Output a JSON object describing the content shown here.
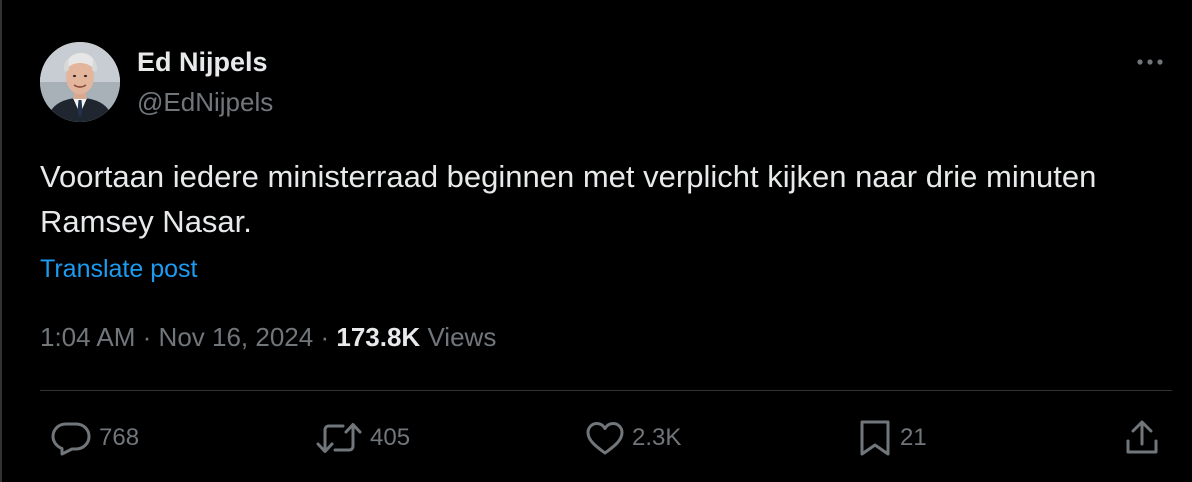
{
  "colors": {
    "background": "#000000",
    "text_primary": "#e7e9ea",
    "text_secondary": "#71767b",
    "link": "#1d9bf0",
    "divider": "#2f3336"
  },
  "author": {
    "display_name": "Ed Nijpels",
    "handle": "@EdNijpels",
    "avatar_icon": "profile-photo"
  },
  "tweet": {
    "text": "Voortaan iedere ministerraad beginnen met verplicht kijken naar drie minuten Ramsey Nasar.",
    "translate_label": "Translate post"
  },
  "meta": {
    "time": "1:04 AM",
    "date": "Nov 16, 2024",
    "separator": "·",
    "views_count": "173.8K",
    "views_label": "Views"
  },
  "actions": {
    "reply_count": "768",
    "repost_count": "405",
    "like_count": "2.3K",
    "bookmark_count": "21"
  },
  "icons": {
    "more": "more-horizontal-icon",
    "reply": "reply-bubble-icon",
    "repost": "repost-arrows-icon",
    "like": "heart-icon",
    "bookmark": "bookmark-icon",
    "share": "share-upload-icon"
  }
}
